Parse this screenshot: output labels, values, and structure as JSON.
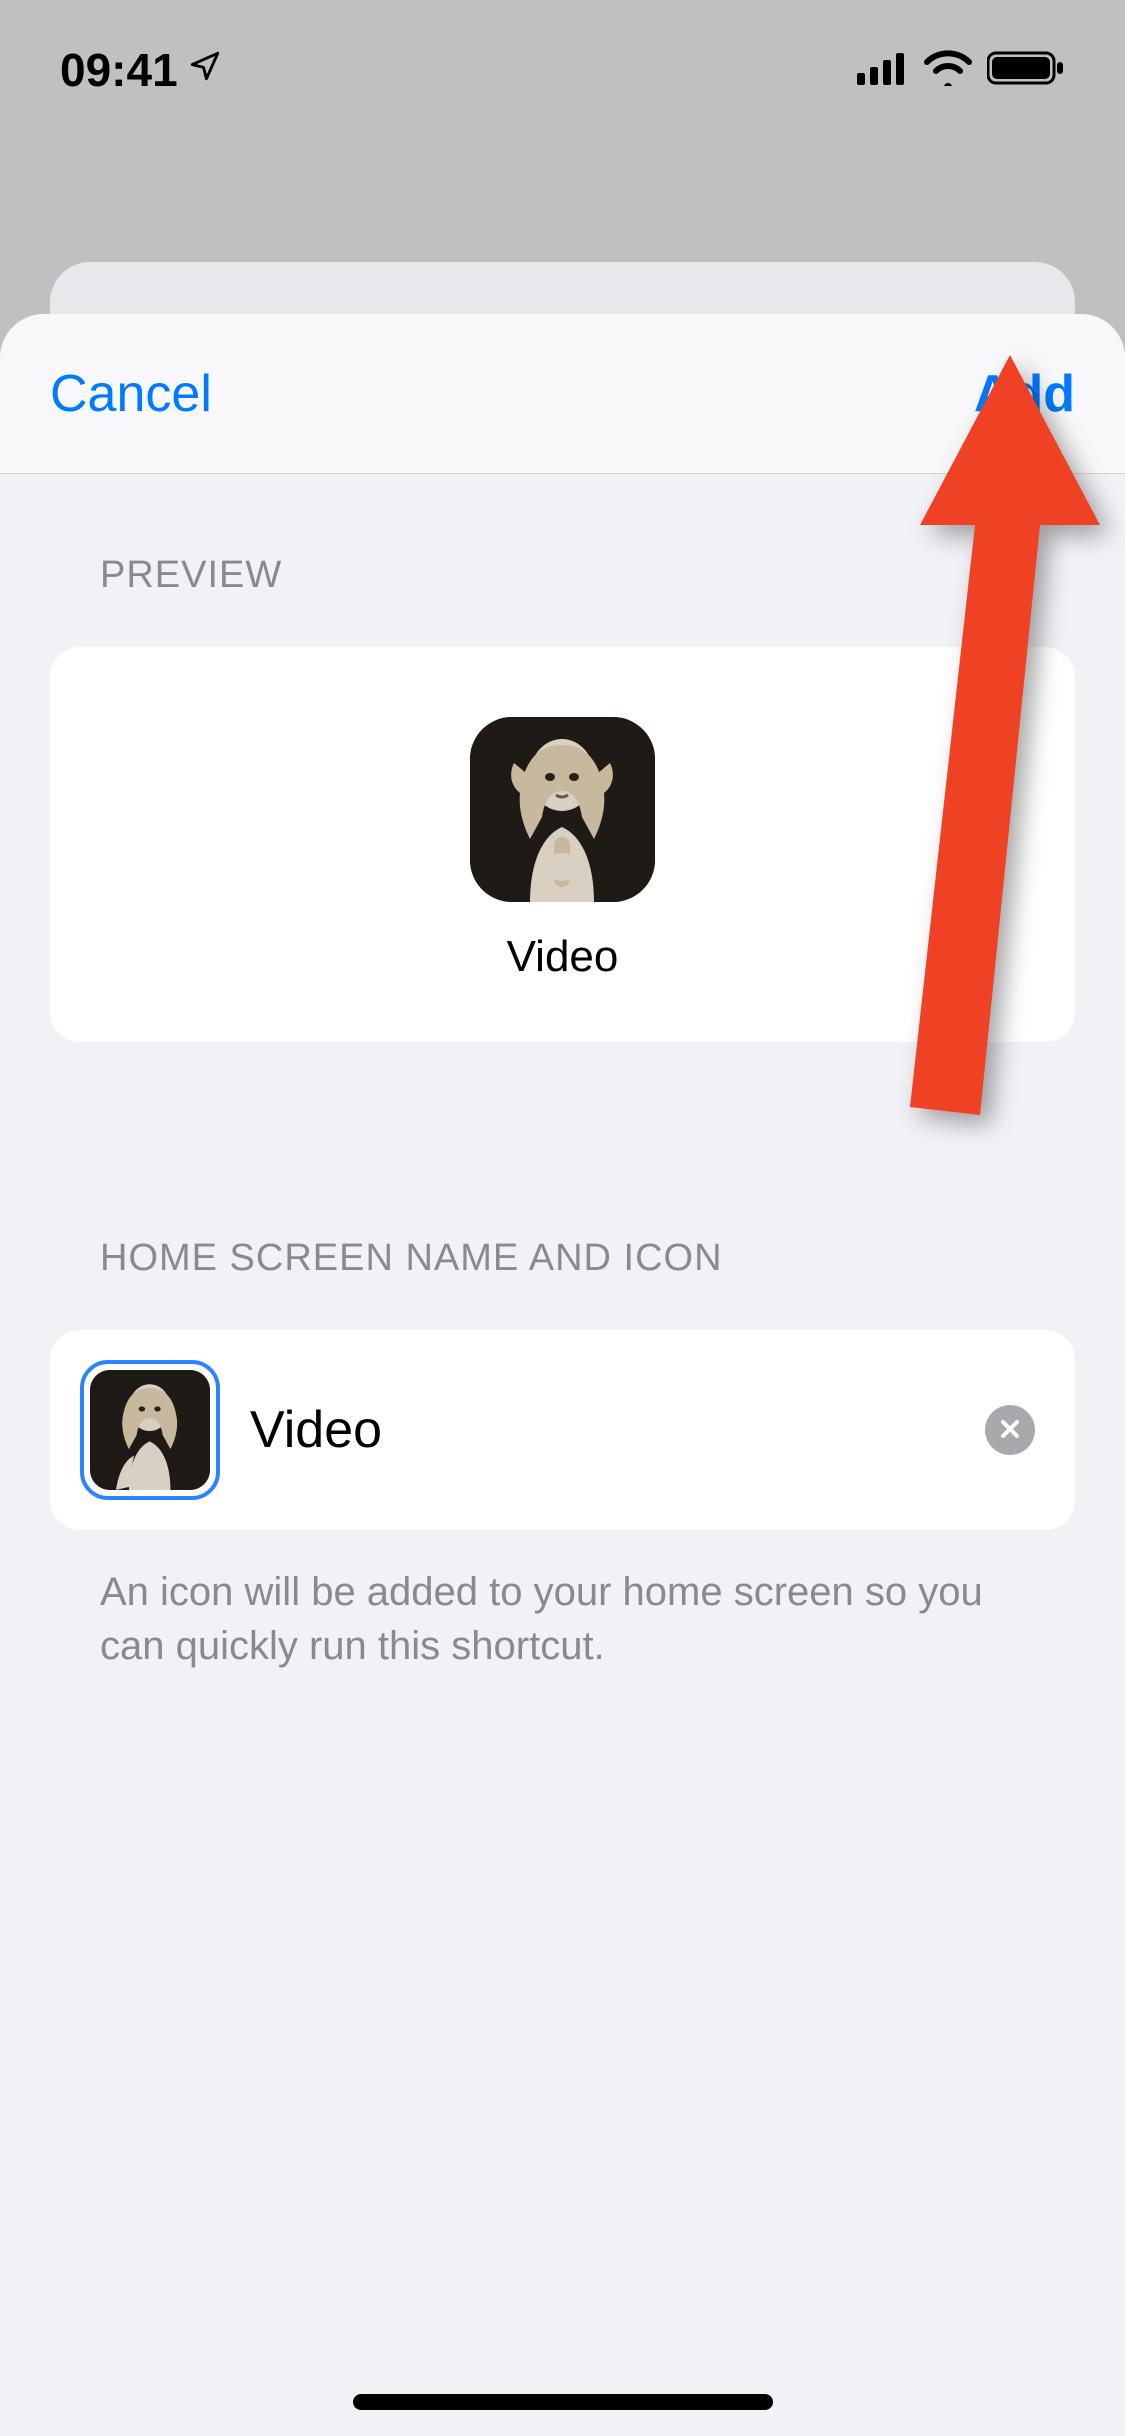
{
  "status": {
    "time": "09:41"
  },
  "header": {
    "cancel_label": "Cancel",
    "add_label": "Add"
  },
  "preview": {
    "section_label": "PREVIEW",
    "app_label": "Video"
  },
  "name_icon": {
    "section_label": "HOME SCREEN NAME AND ICON",
    "input_value": "Video",
    "footer": "An icon will be added to your home screen so you can quickly run this shortcut."
  },
  "colors": {
    "accent": "#007aff",
    "arrow": "#ef4123"
  },
  "icons": {
    "location": "location-arrow-icon",
    "signal": "cellular-signal-icon",
    "wifi": "wifi-icon",
    "battery": "battery-icon",
    "clear": "close-icon"
  }
}
